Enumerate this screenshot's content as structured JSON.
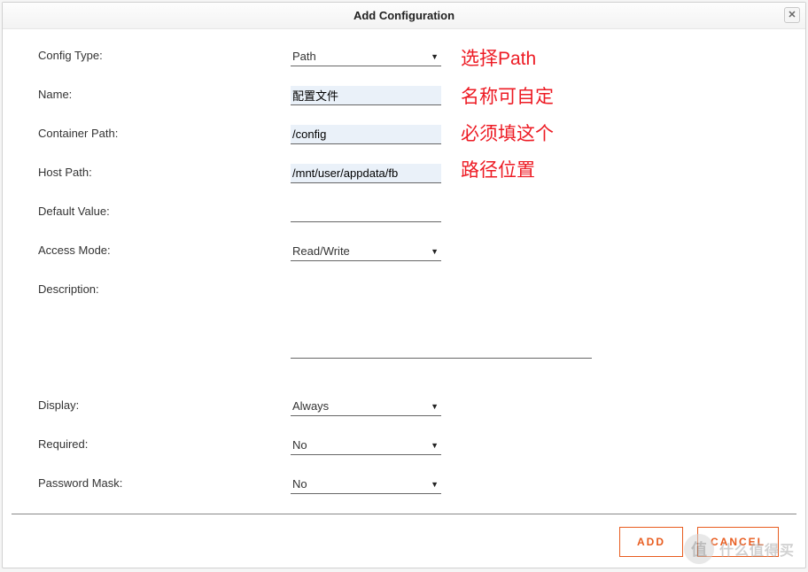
{
  "dialog": {
    "title": "Add Configuration"
  },
  "labels": {
    "config_type": "Config Type:",
    "name": "Name:",
    "container_path": "Container Path:",
    "host_path": "Host Path:",
    "default_value": "Default Value:",
    "access_mode": "Access Mode:",
    "description": "Description:",
    "display": "Display:",
    "required": "Required:",
    "password_mask": "Password Mask:"
  },
  "values": {
    "config_type": "Path",
    "name": "配置文件",
    "container_path": "/config",
    "host_path": "/mnt/user/appdata/fb",
    "default_value": "",
    "access_mode": "Read/Write",
    "description": "",
    "display": "Always",
    "required": "No",
    "password_mask": "No"
  },
  "annotations": {
    "config_type": "选择Path",
    "name": "名称可自定",
    "container_path": "必须填这个",
    "host_path": "路径位置"
  },
  "buttons": {
    "add": "ADD",
    "cancel": "CANCEL"
  },
  "watermark": {
    "coin": "值",
    "text": "什么值得买"
  }
}
